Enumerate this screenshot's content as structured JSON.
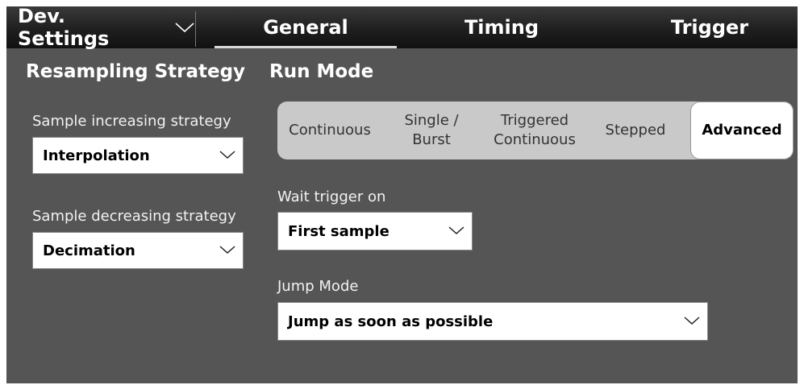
{
  "header": {
    "dev_settings_label": "Dev. Settings",
    "tabs": [
      {
        "label": "General",
        "selected": true
      },
      {
        "label": "Timing",
        "selected": false
      },
      {
        "label": "Trigger",
        "selected": false
      }
    ]
  },
  "resampling": {
    "title": "Resampling Strategy",
    "increasing_label": "Sample increasing strategy",
    "increasing_value": "Interpolation",
    "decreasing_label": "Sample decreasing strategy",
    "decreasing_value": "Decimation"
  },
  "run_mode": {
    "title": "Run Mode",
    "options": [
      {
        "line1": "Continuous",
        "line2": ""
      },
      {
        "line1": "Single /",
        "line2": "Burst"
      },
      {
        "line1": "Triggered",
        "line2": "Continuous"
      },
      {
        "line1": "Stepped",
        "line2": ""
      },
      {
        "line1": "Advanced",
        "line2": ""
      }
    ],
    "selected": "Advanced",
    "wait_trigger_label": "Wait trigger on",
    "wait_trigger_value": "First sample",
    "jump_mode_label": "Jump Mode",
    "jump_mode_value": "Jump as soon as possible"
  },
  "icons": {
    "dropdown": "chevron-down-icon"
  },
  "colors": {
    "panel_bg": "#555555",
    "topbar_bg": "#1f1f1f",
    "segment_bg": "#c9c9c9",
    "active_segment": "#ffffff"
  }
}
